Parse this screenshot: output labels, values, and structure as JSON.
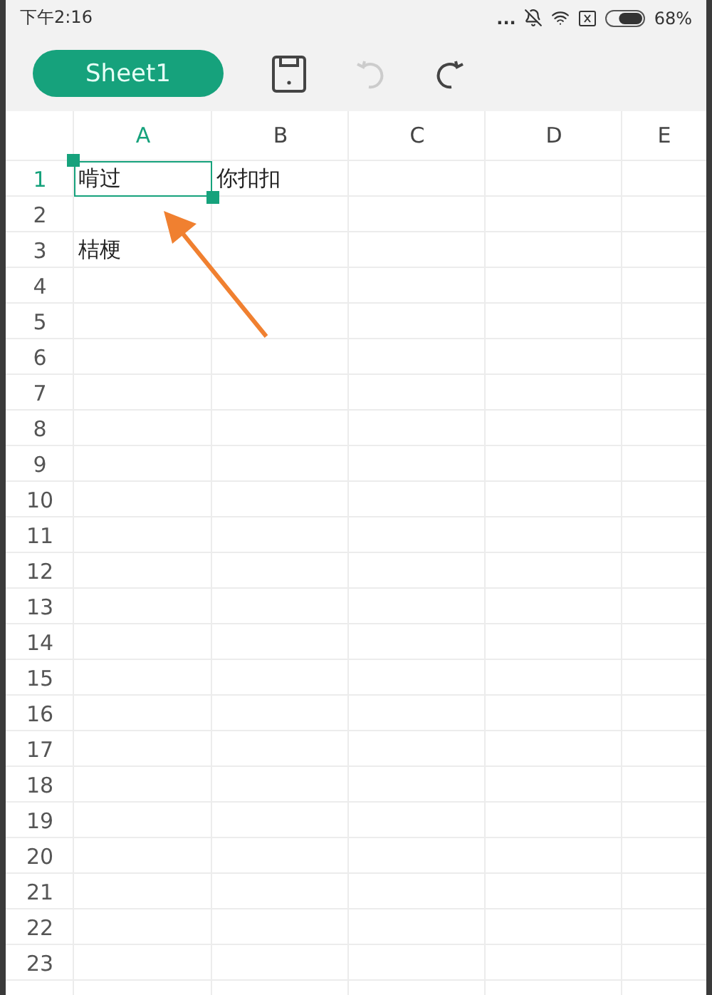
{
  "status_bar": {
    "time": "下午2:16",
    "more": "...",
    "battery_text": "68%",
    "battery": {
      "level": 0.68
    }
  },
  "toolbar": {
    "sheet_tab": {
      "label": "Sheet1",
      "selected": true
    },
    "undo": {
      "disabled": true
    },
    "redo": {
      "disabled": false
    }
  },
  "columns": [
    {
      "label": "A",
      "selected": true
    },
    {
      "label": "B",
      "selected": false
    },
    {
      "label": "C",
      "selected": false
    },
    {
      "label": "D",
      "selected": false
    },
    {
      "label": "E",
      "selected": false
    }
  ],
  "rows": [
    {
      "label": "1",
      "selected": true,
      "cells": [
        {
          "text": "啃过",
          "selected": true
        },
        {
          "text": "你扣扣",
          "selected": false
        }
      ]
    },
    {
      "label": "2",
      "selected": false
    },
    {
      "label": "3",
      "selected": false,
      "cells": [
        {
          "text": "桔梗",
          "selected": false
        }
      ]
    },
    {
      "label": "4",
      "selected": false
    },
    {
      "label": "5",
      "selected": false
    },
    {
      "label": "6",
      "selected": false
    },
    {
      "label": "7",
      "selected": false
    },
    {
      "label": "8",
      "selected": false
    },
    {
      "label": "9",
      "selected": false
    },
    {
      "label": "10",
      "selected": false
    },
    {
      "label": "11",
      "selected": false
    },
    {
      "label": "12",
      "selected": false
    },
    {
      "label": "13",
      "selected": false
    },
    {
      "label": "14",
      "selected": false
    },
    {
      "label": "15",
      "selected": false
    },
    {
      "label": "16",
      "selected": false
    },
    {
      "label": "17",
      "selected": false
    },
    {
      "label": "18",
      "selected": false
    },
    {
      "label": "19",
      "selected": false
    },
    {
      "label": "20",
      "selected": false
    },
    {
      "label": "21",
      "selected": false
    },
    {
      "label": "22",
      "selected": false
    },
    {
      "label": "23",
      "selected": false
    }
  ]
}
